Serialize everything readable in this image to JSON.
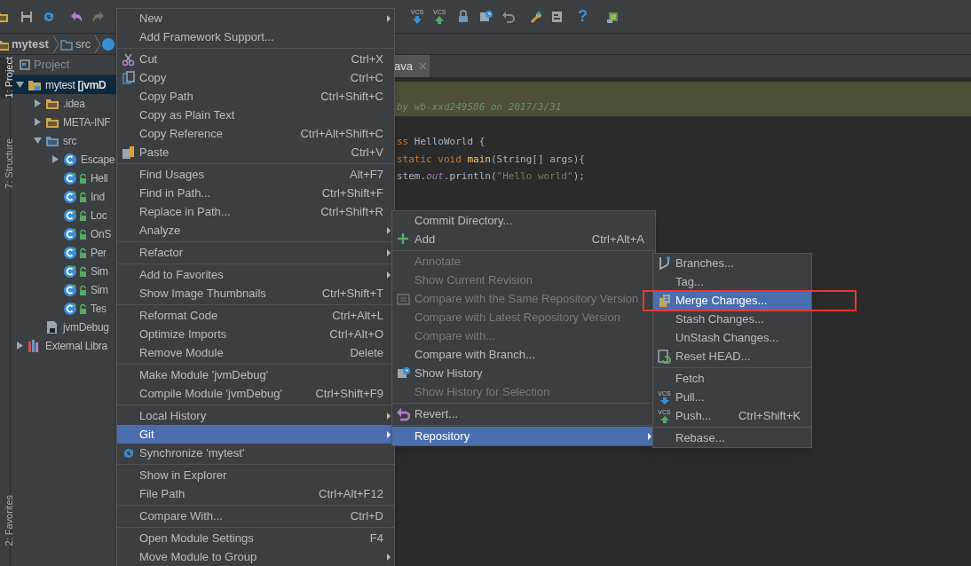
{
  "toolbar": {
    "vcs_labels": [
      "VCS",
      "VCS"
    ],
    "help": "?"
  },
  "breadcrumbs": [
    "mytest",
    "src"
  ],
  "side_tabs": [
    {
      "label": "1: Project",
      "selected": true
    },
    {
      "label": "7: Structure",
      "selected": false
    },
    {
      "label": "2: Favorites",
      "selected": false
    }
  ],
  "project_panel": {
    "title": "Project",
    "tree": [
      {
        "label": "mytest",
        "suffix": "[jvmD",
        "kind": "module",
        "expanded": true,
        "selected": true,
        "children": [
          {
            "label": ".idea",
            "kind": "folder",
            "expanded": false,
            "selected": false
          },
          {
            "label": "META-INF",
            "kind": "folder",
            "expanded": false,
            "selected": false
          },
          {
            "label": "src",
            "kind": "source",
            "expanded": true,
            "selected": false,
            "children": [
              {
                "label": "Escape",
                "kind": "class",
                "expanded": false,
                "selected": false
              },
              {
                "label": "Hell",
                "kind": "locked_class",
                "selected": false
              },
              {
                "label": "Ind",
                "kind": "locked_class",
                "selected": false
              },
              {
                "label": "Loc",
                "kind": "locked_class",
                "selected": false
              },
              {
                "label": "OnS",
                "kind": "locked_class",
                "selected": false
              },
              {
                "label": "Per",
                "kind": "locked_class",
                "selected": false
              },
              {
                "label": "Sim",
                "kind": "locked_class",
                "selected": false
              },
              {
                "label": "Sim",
                "kind": "locked_class",
                "selected": false
              },
              {
                "label": "Tes",
                "kind": "locked_class",
                "selected": false
              }
            ]
          },
          {
            "label": "jvmDebug",
            "kind": "file",
            "selected": false
          }
        ]
      },
      {
        "label": "External Libra",
        "kind": "library",
        "expanded": false,
        "selected": false
      }
    ]
  },
  "editor": {
    "tab": {
      "label": "ava",
      "selected": true
    },
    "lines": [
      {
        "highlight": true
      },
      {
        "highlight": true,
        "tokens": [
          {
            "text": "by wb-xxd249586 on 2017/3/31",
            "kind": "comment"
          }
        ]
      },
      {
        "highlight": false,
        "tokens": [
          {
            "text": "ss",
            "kind": "keyword"
          },
          {
            "text": " HelloWorld {",
            "kind": "plain"
          }
        ]
      },
      {
        "highlight": false,
        "tokens": [
          {
            "text": "static void ",
            "kind": "keyword"
          },
          {
            "text": "main",
            "kind": "method"
          },
          {
            "text": "(String[] args){",
            "kind": "plain"
          }
        ]
      },
      {
        "highlight": false,
        "tokens": [
          {
            "text": "stem.",
            "kind": "plain"
          },
          {
            "text": "out",
            "kind": "field"
          },
          {
            "text": ".println(",
            "kind": "plain"
          },
          {
            "text": "\"Hello world\"",
            "kind": "string"
          },
          {
            "text": ");",
            "kind": "plain"
          }
        ]
      }
    ]
  },
  "context_menu": [
    {
      "kind": "item",
      "label": "New",
      "submenu": true,
      "selected": false,
      "disabled": false
    },
    {
      "kind": "item",
      "label": "Add Framework Support...",
      "submenu": false,
      "selected": false,
      "disabled": false
    },
    {
      "kind": "separator"
    },
    {
      "kind": "item",
      "label": "Cut",
      "shortcut": "Ctrl+X",
      "submenu": false,
      "selected": false,
      "disabled": false
    },
    {
      "kind": "item",
      "label": "Copy",
      "shortcut": "Ctrl+C",
      "submenu": false,
      "selected": false,
      "disabled": false
    },
    {
      "kind": "item",
      "label": "Copy Path",
      "shortcut": "Ctrl+Shift+C",
      "submenu": false,
      "selected": false,
      "disabled": false
    },
    {
      "kind": "item",
      "label": "Copy as Plain Text",
      "submenu": false,
      "selected": false,
      "disabled": false
    },
    {
      "kind": "item",
      "label": "Copy Reference",
      "shortcut": "Ctrl+Alt+Shift+C",
      "submenu": false,
      "selected": false,
      "disabled": false
    },
    {
      "kind": "item",
      "label": "Paste",
      "shortcut": "Ctrl+V",
      "submenu": false,
      "selected": false,
      "disabled": false
    },
    {
      "kind": "separator"
    },
    {
      "kind": "item",
      "label": "Find Usages",
      "shortcut": "Alt+F7",
      "submenu": false,
      "selected": false,
      "disabled": false
    },
    {
      "kind": "item",
      "label": "Find in Path...",
      "shortcut": "Ctrl+Shift+F",
      "submenu": false,
      "selected": false,
      "disabled": false
    },
    {
      "kind": "item",
      "label": "Replace in Path...",
      "shortcut": "Ctrl+Shift+R",
      "submenu": false,
      "selected": false,
      "disabled": false
    },
    {
      "kind": "item",
      "label": "Analyze",
      "submenu": true,
      "selected": false,
      "disabled": false
    },
    {
      "kind": "separator"
    },
    {
      "kind": "item",
      "label": "Refactor",
      "submenu": true,
      "selected": false,
      "disabled": false
    },
    {
      "kind": "separator"
    },
    {
      "kind": "item",
      "label": "Add to Favorites",
      "submenu": true,
      "selected": false,
      "disabled": false
    },
    {
      "kind": "item",
      "label": "Show Image Thumbnails",
      "shortcut": "Ctrl+Shift+T",
      "submenu": false,
      "selected": false,
      "disabled": false
    },
    {
      "kind": "separator"
    },
    {
      "kind": "item",
      "label": "Reformat Code",
      "shortcut": "Ctrl+Alt+L",
      "submenu": false,
      "selected": false,
      "disabled": false
    },
    {
      "kind": "item",
      "label": "Optimize Imports",
      "shortcut": "Ctrl+Alt+O",
      "submenu": false,
      "selected": false,
      "disabled": false
    },
    {
      "kind": "item",
      "label": "Remove Module",
      "shortcut": "Delete",
      "submenu": false,
      "selected": false,
      "disabled": false
    },
    {
      "kind": "separator"
    },
    {
      "kind": "item",
      "label": "Make Module 'jvmDebug'",
      "submenu": false,
      "selected": false,
      "disabled": false
    },
    {
      "kind": "item",
      "label": "Compile Module 'jvmDebug'",
      "shortcut": "Ctrl+Shift+F9",
      "submenu": false,
      "selected": false,
      "disabled": false
    },
    {
      "kind": "separator"
    },
    {
      "kind": "item",
      "label": "Local History",
      "submenu": true,
      "selected": false,
      "disabled": false
    },
    {
      "kind": "item",
      "label": "Git",
      "submenu": true,
      "selected": true,
      "disabled": false
    },
    {
      "kind": "item",
      "label": "Synchronize 'mytest'",
      "submenu": false,
      "selected": false,
      "disabled": false
    },
    {
      "kind": "separator"
    },
    {
      "kind": "item",
      "label": "Show in Explorer",
      "submenu": false,
      "selected": false,
      "disabled": false
    },
    {
      "kind": "item",
      "label": "File Path",
      "shortcut": "Ctrl+Alt+F12",
      "submenu": false,
      "selected": false,
      "disabled": false
    },
    {
      "kind": "separator"
    },
    {
      "kind": "item",
      "label": "Compare With...",
      "shortcut": "Ctrl+D",
      "submenu": false,
      "selected": false,
      "disabled": false
    },
    {
      "kind": "separator"
    },
    {
      "kind": "item",
      "label": "Open Module Settings",
      "shortcut": "F4",
      "submenu": false,
      "selected": false,
      "disabled": false
    },
    {
      "kind": "item",
      "label": "Move Module to Group",
      "submenu": true,
      "selected": false,
      "disabled": false
    }
  ],
  "git_menu": [
    {
      "kind": "item",
      "label": "Commit Directory...",
      "submenu": false,
      "selected": false,
      "disabled": false
    },
    {
      "kind": "item",
      "label": "Add",
      "shortcut": "Ctrl+Alt+A",
      "submenu": false,
      "selected": false,
      "disabled": false
    },
    {
      "kind": "separator"
    },
    {
      "kind": "item",
      "label": "Annotate",
      "submenu": false,
      "selected": false,
      "disabled": true
    },
    {
      "kind": "item",
      "label": "Show Current Revision",
      "submenu": false,
      "selected": false,
      "disabled": true
    },
    {
      "kind": "item",
      "label": "Compare with the Same Repository Version",
      "submenu": false,
      "selected": false,
      "disabled": true
    },
    {
      "kind": "item",
      "label": "Compare with Latest Repository Version",
      "submenu": false,
      "selected": false,
      "disabled": true
    },
    {
      "kind": "item",
      "label": "Compare with...",
      "submenu": false,
      "selected": false,
      "disabled": true
    },
    {
      "kind": "item",
      "label": "Compare with Branch...",
      "submenu": false,
      "selected": false,
      "disabled": false
    },
    {
      "kind": "item",
      "label": "Show History",
      "submenu": false,
      "selected": false,
      "disabled": false
    },
    {
      "kind": "item",
      "label": "Show History for Selection",
      "submenu": false,
      "selected": false,
      "disabled": true
    },
    {
      "kind": "separator"
    },
    {
      "kind": "item",
      "label": "Revert...",
      "submenu": false,
      "selected": false,
      "disabled": false
    },
    {
      "kind": "separator"
    },
    {
      "kind": "item",
      "label": "Repository",
      "submenu": true,
      "selected": true,
      "disabled": false
    }
  ],
  "repository_menu": [
    {
      "kind": "item",
      "label": "Branches...",
      "submenu": false,
      "selected": false,
      "disabled": false
    },
    {
      "kind": "item",
      "label": "Tag...",
      "submenu": false,
      "selected": false,
      "disabled": false
    },
    {
      "kind": "item",
      "label": "Merge Changes...",
      "submenu": false,
      "selected": true,
      "disabled": false
    },
    {
      "kind": "item",
      "label": "Stash Changes...",
      "submenu": false,
      "selected": false,
      "disabled": false
    },
    {
      "kind": "item",
      "label": "UnStash Changes...",
      "submenu": false,
      "selected": false,
      "disabled": false
    },
    {
      "kind": "item",
      "label": "Reset HEAD...",
      "submenu": false,
      "selected": false,
      "disabled": false
    },
    {
      "kind": "separator"
    },
    {
      "kind": "item",
      "label": "Fetch",
      "submenu": false,
      "selected": false,
      "disabled": false
    },
    {
      "kind": "item",
      "label": "Pull...",
      "icon_text": "VCS",
      "submenu": false,
      "selected": false,
      "disabled": false
    },
    {
      "kind": "item",
      "label": "Push...",
      "icon_text": "VCS",
      "shortcut": "Ctrl+Shift+K",
      "submenu": false,
      "selected": false,
      "disabled": false
    },
    {
      "kind": "separator"
    },
    {
      "kind": "item",
      "label": "Rebase...",
      "submenu": false,
      "selected": false,
      "disabled": false
    }
  ]
}
